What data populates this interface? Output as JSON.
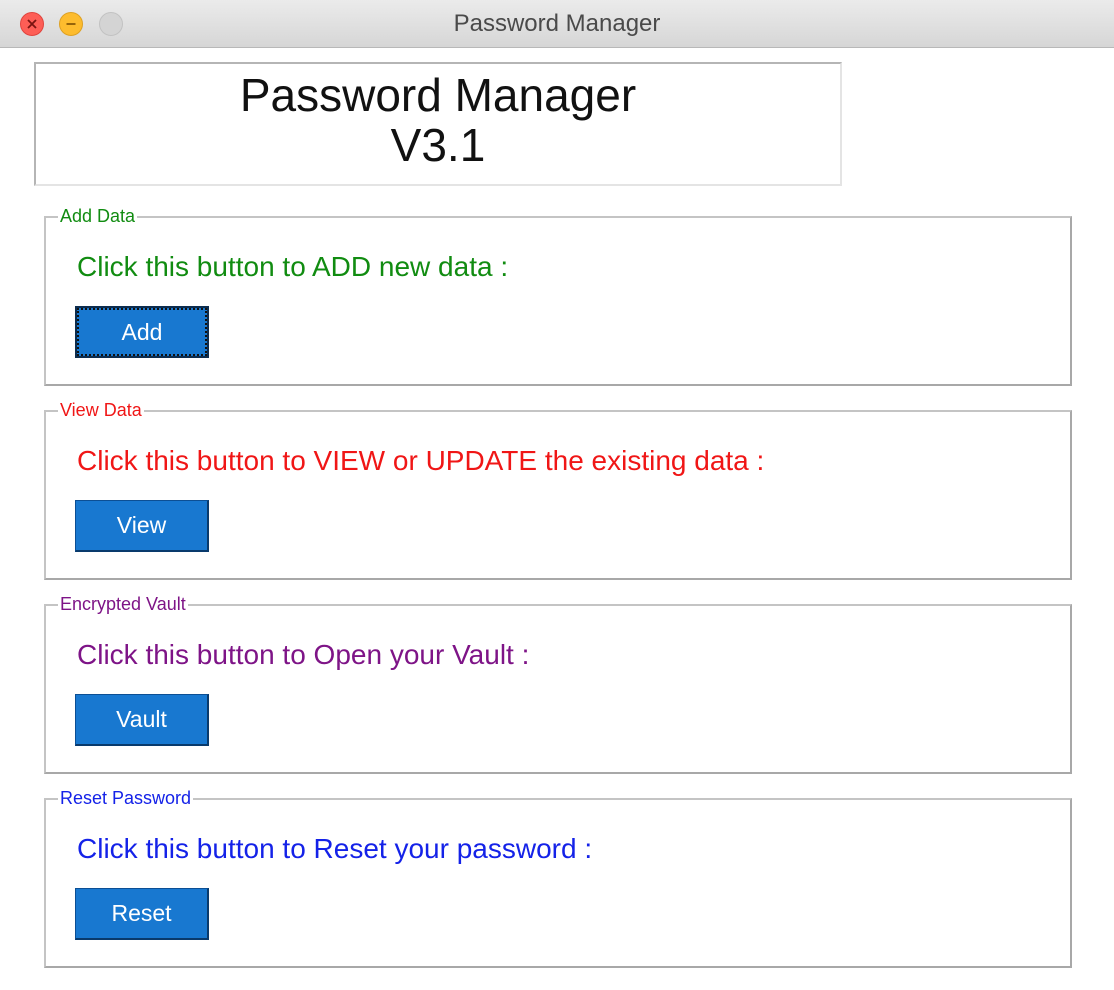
{
  "window": {
    "title": "Password Manager"
  },
  "header": {
    "line1": "Password Manager",
    "line2": "V3.1"
  },
  "sections": [
    {
      "label": "Add Data",
      "text": "Click this button to ADD new data :",
      "button": "Add",
      "color": "#118c11"
    },
    {
      "label": "View Data",
      "text": "Click this button to VIEW or UPDATE the existing data :",
      "button": "View",
      "color": "#f01616"
    },
    {
      "label": "Encrypted Vault",
      "text": "Click this button to Open your Vault :",
      "button": "Vault",
      "color": "#7e1487"
    },
    {
      "label": "Reset Password",
      "text": "Click this button to Reset your password :",
      "button": "Reset",
      "color": "#1422e8"
    }
  ],
  "colors": {
    "button_bg": "#1878d0",
    "button_text": "#ffffff"
  }
}
